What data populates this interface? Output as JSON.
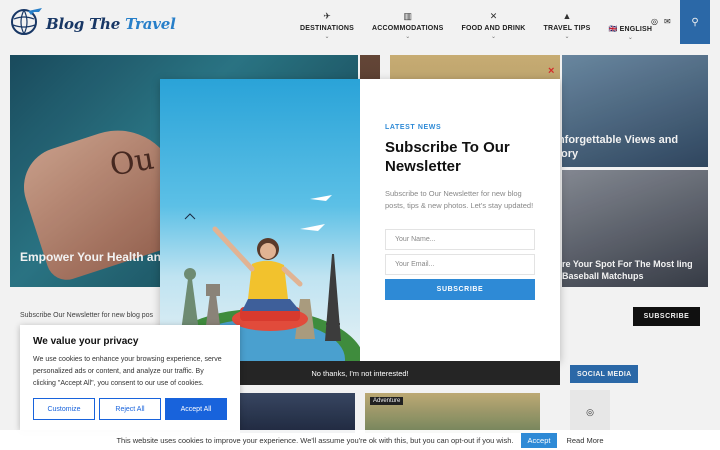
{
  "logo": {
    "part1": "Blog The ",
    "part2": "Travel"
  },
  "nav": [
    {
      "label": "DESTINATIONS",
      "icon": "✈",
      "icon_name": "plane-icon",
      "caret": "⌄"
    },
    {
      "label": "ACCOMMODATIONS",
      "icon": "▥",
      "icon_name": "map-icon",
      "caret": "⌄"
    },
    {
      "label": "FOOD AND DRINK",
      "icon": "✕",
      "icon_name": "utensils-icon",
      "caret": "⌄"
    },
    {
      "label": "TRAVEL TIPS",
      "icon": "▲",
      "icon_name": "road-icon",
      "caret": "⌄"
    },
    {
      "label": "ENGLISH",
      "icon": "",
      "icon_name": "",
      "caret": "⌄",
      "flag": "🇬🇧"
    }
  ],
  "header_social": {
    "instagram": "◎",
    "email": "✉"
  },
  "search_icon": "⚲",
  "hero": {
    "bottle_text": "Ou",
    "caption_a": "Empower Your Health and Trusted Supplements and",
    "caption_d": "Unforgettable Views and Story",
    "caption_e": "re Your Spot For The Most ling Baseball Matchups"
  },
  "sub_strip_text": "Subscribe Our Newsletter for new blog pos",
  "sub_strip_button": "SUBSCRIBE",
  "pager": {
    "prev": "‹",
    "next": "›"
  },
  "social_media_label": "SOCIAL MEDIA",
  "social_instagram": "◎",
  "card2_tag": "Adventure",
  "modal": {
    "close": "×",
    "eyebrow": "LATEST NEWS",
    "title": "Subscribe To Our Newsletter",
    "description": "Subscribe to Our Newsletter for new blog posts, tips & new photos. Let's stay updated!",
    "name_placeholder": "Your Name...",
    "email_placeholder": "Your Email...",
    "button": "SUBSCRIBE",
    "decline": "No thanks, I'm not interested!"
  },
  "cookie": {
    "title": "We value your privacy",
    "text": "We use cookies to enhance your browsing experience, serve personalized ads or content, and analyze our traffic. By clicking \"Accept All\", you consent to our use of cookies.",
    "customize": "Customize",
    "reject": "Reject All",
    "accept": "Accept All"
  },
  "bottom_bar": {
    "text": "This website uses cookies to improve your experience. We'll assume you're ok with this, but you can opt-out if you wish.",
    "accept": "Accept",
    "read_more": "Read More"
  }
}
